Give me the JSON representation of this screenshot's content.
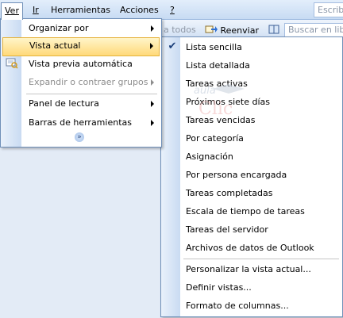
{
  "menubar": {
    "items": [
      {
        "label": "Ver"
      },
      {
        "label": "Ir"
      },
      {
        "label": "Herramientas"
      },
      {
        "label": "Acciones"
      },
      {
        "label": "?"
      }
    ],
    "search_text": "Escriba"
  },
  "toolbar": {
    "reply_all_label": "a todos",
    "forward_label": "Reenviar",
    "search_label": "Buscar en libr"
  },
  "view_menu": {
    "items": [
      {
        "label": "Organizar por"
      },
      {
        "label": "Vista actual"
      },
      {
        "label": "Vista previa automática"
      },
      {
        "label": "Expandir o contraer grupos"
      },
      {
        "label": "Panel de lectura"
      },
      {
        "label": "Barras de herramientas"
      }
    ]
  },
  "current_view_menu": {
    "items": [
      {
        "label": "Lista sencilla",
        "checked": true
      },
      {
        "label": "Lista detallada"
      },
      {
        "label": "Tareas activas"
      },
      {
        "label": "Próximos siete días"
      },
      {
        "label": "Tareas vencidas"
      },
      {
        "label": "Por categoría"
      },
      {
        "label": "Asignación"
      },
      {
        "label": "Por persona encargada"
      },
      {
        "label": "Tareas completadas"
      },
      {
        "label": "Escala de tiempo de tareas"
      },
      {
        "label": "Tareas del servidor"
      },
      {
        "label": "Archivos de datos de Outlook"
      },
      {
        "label": "Personalizar la vista actual..."
      },
      {
        "label": "Definir vistas..."
      },
      {
        "label": "Formato de columnas..."
      }
    ]
  },
  "watermark": {
    "text_top": "aula",
    "text_bottom": "Clic"
  },
  "colors": {
    "highlight_top": "#fff5c9",
    "highlight_bottom": "#ffd97a",
    "menu_border": "#6f8fb8"
  }
}
